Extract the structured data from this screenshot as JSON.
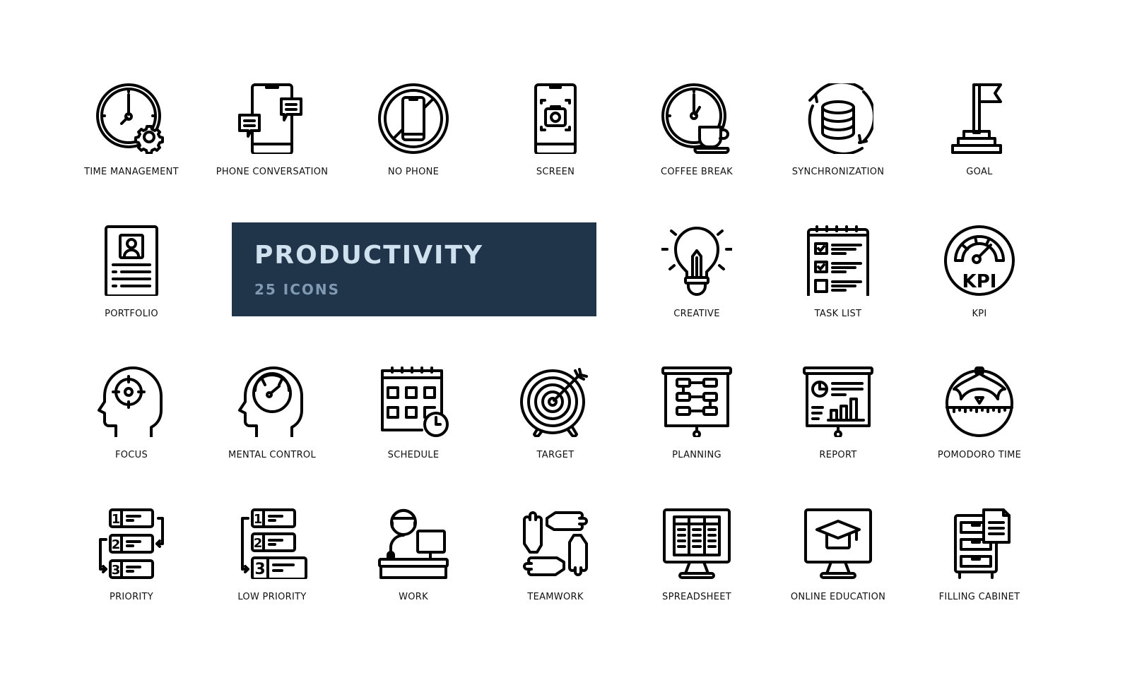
{
  "banner": {
    "title": "PRODUCTIVITY",
    "subtitle": "25 ICONS",
    "background_color": "#203549",
    "title_color": "#cfe0ee",
    "subtitle_color": "#7f9ab2"
  },
  "icons": [
    {
      "label": "TIME MANAGEMENT",
      "icon": "clock-gear-icon"
    },
    {
      "label": "PHONE CONVERSATION",
      "icon": "phone-chat-icon"
    },
    {
      "label": "NO PHONE",
      "icon": "no-phone-icon"
    },
    {
      "label": "SCREEN",
      "icon": "phone-screenshot-icon"
    },
    {
      "label": "COFFEE BREAK",
      "icon": "clock-coffee-icon"
    },
    {
      "label": "SYNCHRONIZATION",
      "icon": "database-sync-icon"
    },
    {
      "label": "GOAL",
      "icon": "flag-podium-icon"
    },
    {
      "label": "PORTFOLIO",
      "icon": "resume-icon"
    },
    {
      "label": "CREATIVE",
      "icon": "lightbulb-pencil-icon"
    },
    {
      "label": "TASK LIST",
      "icon": "checklist-icon"
    },
    {
      "label": "KPI",
      "icon": "kpi-gauge-icon",
      "glyph": "KPI"
    },
    {
      "label": "FOCUS",
      "icon": "head-target-icon"
    },
    {
      "label": "MENTAL CONTROL",
      "icon": "head-gauge-icon"
    },
    {
      "label": "SCHEDULE",
      "icon": "calendar-clock-icon"
    },
    {
      "label": "TARGET",
      "icon": "dartboard-icon"
    },
    {
      "label": "PLANNING",
      "icon": "flowchart-board-icon"
    },
    {
      "label": "REPORT",
      "icon": "report-board-icon"
    },
    {
      "label": "POMODORO TIME",
      "icon": "tomato-timer-icon"
    },
    {
      "label": "PRIORITY",
      "icon": "priority-list-icon",
      "numbers": [
        "1",
        "2",
        "3"
      ]
    },
    {
      "label": "LOW PRIORITY",
      "icon": "low-priority-list-icon",
      "numbers": [
        "1",
        "2",
        "3"
      ]
    },
    {
      "label": "WORK",
      "icon": "person-desk-computer-icon"
    },
    {
      "label": "TEAMWORK",
      "icon": "hands-together-icon"
    },
    {
      "label": "SPREADSHEET",
      "icon": "monitor-spreadsheet-icon"
    },
    {
      "label": "ONLINE EDUCATION",
      "icon": "monitor-graduation-cap-icon"
    },
    {
      "label": "FILLING CABINET",
      "icon": "filing-cabinet-icon"
    }
  ]
}
